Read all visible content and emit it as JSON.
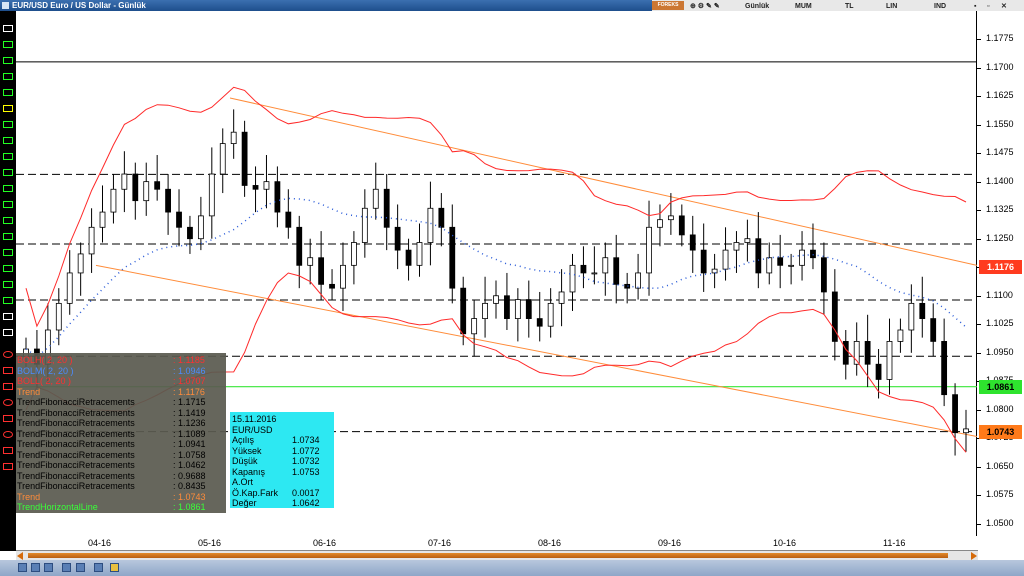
{
  "window": {
    "title": "EUR/USD Euro / US Dollar - Günlük"
  },
  "toolbar": {
    "logo": "FOREKS",
    "period": "Günlük",
    "chart_type": "MUM",
    "currency": "TL",
    "scale": "LIN",
    "indicators": "IND"
  },
  "y_axis": {
    "ticks": [
      "1.1775",
      "1.1700",
      "1.1625",
      "1.1550",
      "1.1475",
      "1.1400",
      "1.1325",
      "1.1250",
      "1.1175",
      "1.1100",
      "1.1025",
      "1.0950",
      "1.0875",
      "1.0800",
      "1.0725",
      "1.0650",
      "1.0575",
      "1.0500"
    ],
    "tags": [
      {
        "label": "1.1176",
        "bg": "#ff3b1f",
        "color": "#ffffff"
      },
      {
        "label": "1.0861",
        "bg": "#2ee32e",
        "color": "#000000"
      },
      {
        "label": "1.0743",
        "bg": "#ff7a1a",
        "color": "#000000"
      }
    ]
  },
  "x_axis": {
    "ticks": [
      "04-16",
      "05-16",
      "06-16",
      "07-16",
      "08-16",
      "09-16",
      "10-16",
      "11-16"
    ]
  },
  "legend": [
    {
      "name": "BOLH( 2, 20 )",
      "value": ": 1.1185",
      "color": "#ff3030"
    },
    {
      "name": "BOLM( 2, 20 )",
      "value": ": 1.0946",
      "color": "#4a8cff"
    },
    {
      "name": "BOLL( 2, 20 )",
      "value": ": 1.0707",
      "color": "#ff3030"
    },
    {
      "name": "Trend",
      "value": ": 1.1176",
      "color": "#ff8c3a"
    },
    {
      "name": "TrendFibonacciRetracements",
      "value": ": 1.1715",
      "color": "#000000"
    },
    {
      "name": "TrendFibonacciRetracements",
      "value": ": 1.1419",
      "color": "#000000"
    },
    {
      "name": "TrendFibonacciRetracements",
      "value": ": 1.1236",
      "color": "#000000"
    },
    {
      "name": "TrendFibonacciRetracements",
      "value": ": 1.1089",
      "color": "#000000"
    },
    {
      "name": "TrendFibonacciRetracements",
      "value": ": 1.0941",
      "color": "#000000"
    },
    {
      "name": "TrendFibonacciRetracements",
      "value": ": 1.0758",
      "color": "#000000"
    },
    {
      "name": "TrendFibonacciRetracements",
      "value": ": 1.0462",
      "color": "#000000"
    },
    {
      "name": "TrendFibonacciRetracements",
      "value": ": 0.9688",
      "color": "#000000"
    },
    {
      "name": "TrendFibonacciRetracements",
      "value": ": 0.8435",
      "color": "#000000"
    },
    {
      "name": "Trend",
      "value": ": 1.0743",
      "color": "#ff8c3a"
    },
    {
      "name": "TrendHorizontalLine",
      "value": ": 1.0861",
      "color": "#39ff39"
    }
  ],
  "info": {
    "date": "15.11.2016",
    "symbol": "EUR/USD",
    "rows": [
      {
        "k": "Açılış",
        "v": "1.0734"
      },
      {
        "k": "Yüksek",
        "v": "1.0772"
      },
      {
        "k": "Düşük",
        "v": "1.0732"
      },
      {
        "k": "Kapanış",
        "v": "1.0753"
      },
      {
        "k": "Ö.Kap.Fark",
        "v": "0.0017"
      },
      {
        "k": "Değer",
        "v": "1.0642"
      }
    ],
    "aort_label": "A.Ort"
  },
  "chart_data": {
    "type": "candlestick",
    "y_range": [
      1.045,
      1.182
    ],
    "fib_levels": [
      1.1715,
      1.1419,
      1.1236,
      1.1089,
      1.0941,
      1.0743
    ],
    "horizontal_line": 1.0861,
    "close_series": [
      1.096,
      1.092,
      1.101,
      1.108,
      1.116,
      1.121,
      1.128,
      1.132,
      1.138,
      1.142,
      1.135,
      1.14,
      1.138,
      1.132,
      1.128,
      1.125,
      1.131,
      1.142,
      1.15,
      1.153,
      1.139,
      1.138,
      1.14,
      1.132,
      1.128,
      1.118,
      1.12,
      1.113,
      1.112,
      1.118,
      1.124,
      1.133,
      1.138,
      1.128,
      1.122,
      1.118,
      1.124,
      1.133,
      1.128,
      1.112,
      1.1,
      1.104,
      1.108,
      1.11,
      1.104,
      1.109,
      1.104,
      1.102,
      1.108,
      1.111,
      1.118,
      1.116,
      1.116,
      1.12,
      1.113,
      1.112,
      1.116,
      1.128,
      1.13,
      1.131,
      1.126,
      1.122,
      1.116,
      1.117,
      1.122,
      1.124,
      1.125,
      1.116,
      1.12,
      1.118,
      1.118,
      1.122,
      1.12,
      1.111,
      1.098,
      1.092,
      1.098,
      1.092,
      1.088,
      1.098,
      1.101,
      1.108,
      1.104,
      1.098,
      1.084,
      1.074,
      1.075
    ],
    "series_labels": [
      "BOLH( 2, 20 )",
      "BOLM( 2, 20 )",
      "BOLL( 2, 20 )"
    ]
  }
}
